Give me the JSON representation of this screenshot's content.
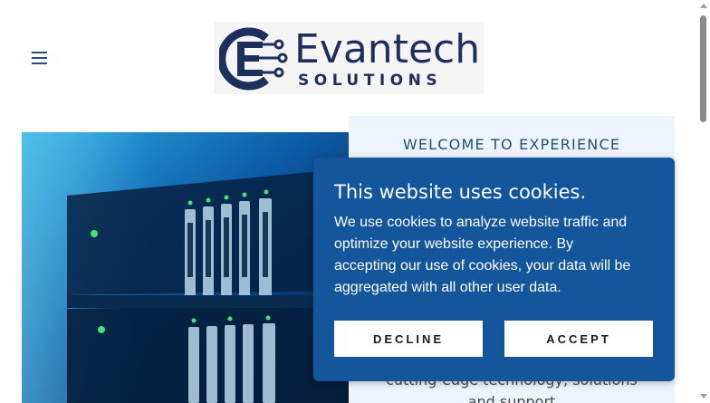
{
  "header": {
    "menu_icon": "hamburger-menu-icon",
    "logo": {
      "word": "Evantech",
      "sub": "SOLUTIONS",
      "mark_icon": "circuit-e-logo-icon",
      "brand_color": "#1d2f5c"
    }
  },
  "hero": {
    "image_icon": "server-rack-image"
  },
  "welcome": {
    "title": "WELCOME TO EXPERIENCE",
    "body_lines": [
      "cutting-edge technology, solutions",
      "and support"
    ],
    "background": "#eef4fb"
  },
  "cookie": {
    "title": "This website uses cookies.",
    "text_lines": [
      "We use cookies to analyze website traffic and",
      "optimize your website experience. By",
      "accepting our use of cookies, your data will be",
      "aggregated with all other user data."
    ],
    "decline_label": "DECLINE",
    "accept_label": "ACCEPT",
    "background": "#13569b"
  },
  "scrollbar": {
    "up_icon": "scroll-up-arrow-icon",
    "down_icon": "scroll-down-arrow-icon"
  }
}
